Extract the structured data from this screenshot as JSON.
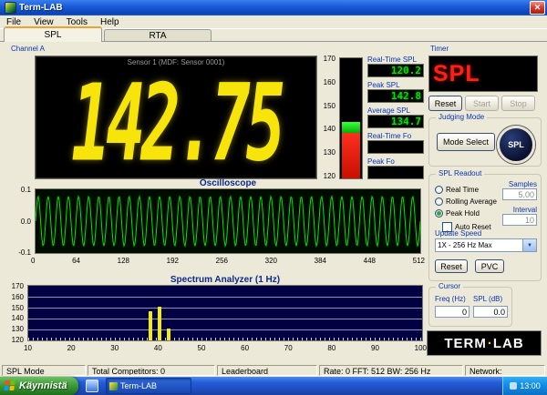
{
  "colors": {
    "titlebar_blue": "#1c5cd8",
    "label_blue": "#0a35b4",
    "seg_yellow": "#f6e40a",
    "seg_green": "#00e200",
    "meter_red": "#c80f00",
    "meter_green": "#00b000",
    "timer_red": "#ff1f14",
    "spectrum_bar_yellow": "#f2ef00",
    "spectrum_bg": "#000042",
    "taskbar_blue": "#245edb",
    "start_green": "#3f9c3a"
  },
  "window": {
    "title": "Term-LAB",
    "close_glyph": "✕"
  },
  "menu": {
    "items": [
      "File",
      "View",
      "Tools",
      "Help"
    ]
  },
  "tabs": {
    "spl": "SPL",
    "rta": "RTA"
  },
  "channel": {
    "label": "Channel A",
    "sensor_header": "Sensor 1 (MDF: Sensor 0001)",
    "main_value": "142.75"
  },
  "meter": {
    "ticks": [
      "170",
      "160",
      "150",
      "140",
      "130",
      "120"
    ],
    "red_pct": 38,
    "green_pct": 9
  },
  "readouts": [
    {
      "label": "Real-Time SPL",
      "value": "120.2"
    },
    {
      "label": "Peak SPL",
      "value": "142.8"
    },
    {
      "label": "Average SPL",
      "value": "134.7"
    },
    {
      "label": "Real-Time Fo",
      "value": ""
    },
    {
      "label": "Peak Fo",
      "value": ""
    }
  ],
  "timer": {
    "title": "Timer",
    "display": "SPL",
    "buttons": [
      {
        "label": "Reset",
        "enabled": true
      },
      {
        "label": "Start",
        "enabled": false
      },
      {
        "label": "Stop",
        "enabled": false
      }
    ]
  },
  "judging": {
    "title": "Judging Mode",
    "mode_button": "Mode Select",
    "badge": "SPL"
  },
  "spl_readout": {
    "title": "SPL Readout",
    "radios": [
      {
        "label": "Real Time",
        "selected": false
      },
      {
        "label": "Rolling Average",
        "selected": false
      },
      {
        "label": "Peak Hold",
        "selected": true
      }
    ],
    "auto_reset_label": "Auto Reset",
    "samples_label": "Samples",
    "samples_value": "5.00",
    "interval_label": "Interval",
    "interval_value": "10",
    "update_speed_label": "Update Speed",
    "update_speed_value": "1X - 256 Hz Max",
    "reset_button": "Reset",
    "pvc_button": "PVC"
  },
  "oscilloscope": {
    "title": "Oscilloscope",
    "y_ticks": [
      "0.1",
      "0.0",
      "-0.1"
    ],
    "x_ticks": [
      "0",
      "64",
      "128",
      "192",
      "256",
      "320",
      "384",
      "448",
      "512"
    ],
    "cycles": 38,
    "amplitude": 0.78
  },
  "spectrum": {
    "title": "Spectrum Analyzer (1 Hz)",
    "y_ticks": [
      "170",
      "160",
      "150",
      "140",
      "130",
      "120"
    ],
    "x_ticks": [
      "10",
      "20",
      "30",
      "40",
      "50",
      "60",
      "70",
      "80",
      "90",
      "100"
    ],
    "x_min": 10,
    "x_max": 100,
    "y_min": 120,
    "y_max": 170,
    "bars": [
      {
        "freq": 38,
        "spl": 147
      },
      {
        "freq": 40,
        "spl": 151
      },
      {
        "freq": 42,
        "spl": 131
      }
    ]
  },
  "cursor": {
    "title": "Cursor",
    "freq_label": "Freq (Hz)",
    "spl_label": "SPL (dB)",
    "freq_value": "0",
    "spl_value": "0.0"
  },
  "logo": {
    "left": "TERM",
    "dot": "·",
    "right": "LAB"
  },
  "status_bar": {
    "segments": [
      "SPL Mode",
      "Total Competitors: 0",
      "Leaderboard",
      "Rate: 0 FFT: 512 BW: 256 Hz",
      "Network:"
    ]
  },
  "taskbar": {
    "start": "Käynnistä",
    "task": "Term-LAB",
    "clock": "13:00"
  }
}
